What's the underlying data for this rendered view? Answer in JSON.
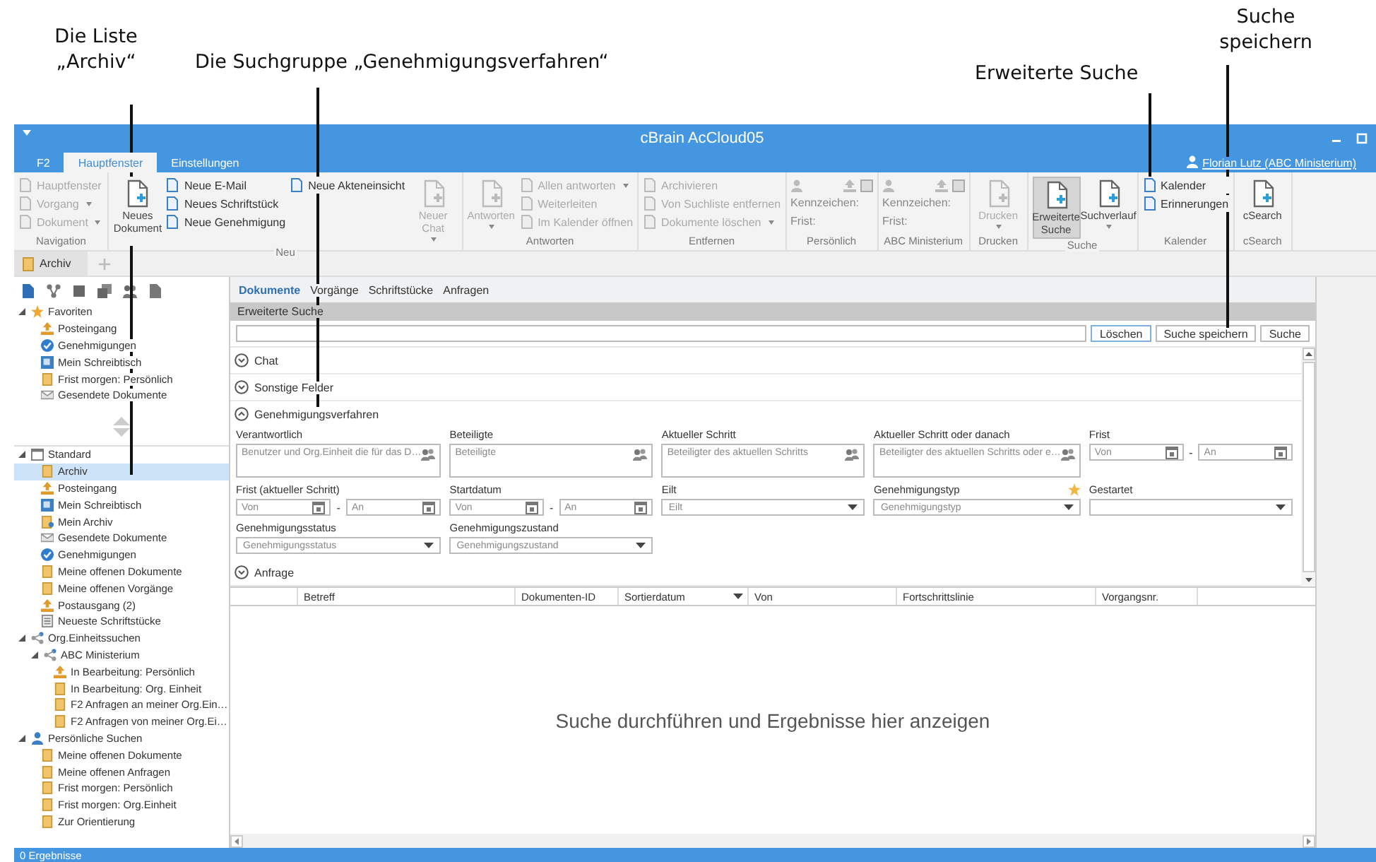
{
  "annotations": [
    {
      "text": "Die Liste „Archiv“"
    },
    {
      "text": "Die Suchgruppe „Genehmigungsverfahren“"
    },
    {
      "text": "Erweiterte Suche"
    },
    {
      "text": "Suche speichern"
    }
  ],
  "window": {
    "title": "cBrain AcCloud05"
  },
  "ribbon_tabs": [
    {
      "label": "F2",
      "selected": false
    },
    {
      "label": "Hauptfenster",
      "selected": true
    },
    {
      "label": "Einstellungen",
      "selected": false
    }
  ],
  "user": "Florian Lutz (ABC Ministerium)",
  "ribbon_groups": [
    {
      "label": "Navigation",
      "items": [
        {
          "kind": "small",
          "label": "Hauptfenster",
          "disabled": true,
          "dropdown": false
        },
        {
          "kind": "small",
          "label": "Vorgang",
          "disabled": true,
          "dropdown": true
        },
        {
          "kind": "small",
          "label": "Dokument",
          "disabled": true,
          "dropdown": true
        }
      ]
    },
    {
      "label": "Neu",
      "items": [
        {
          "kind": "large",
          "label": "Neues Dokument",
          "disabled": false,
          "dropdown": false
        },
        {
          "kind": "small",
          "label": "Neue E-Mail",
          "disabled": false,
          "dropdown": false
        },
        {
          "kind": "small",
          "label": "Neues Schriftstück",
          "disabled": false,
          "dropdown": false
        },
        {
          "kind": "small",
          "label": "Neue Genehmigung",
          "disabled": false,
          "dropdown": false
        },
        {
          "kind": "small",
          "label": "Neue Akteneinsicht",
          "disabled": false,
          "dropdown": false
        },
        {
          "kind": "large",
          "label": "Neuer Chat",
          "disabled": true,
          "dropdown": true
        }
      ]
    },
    {
      "label": "Antworten",
      "items": [
        {
          "kind": "large",
          "label": "Antworten",
          "disabled": true,
          "dropdown": true
        },
        {
          "kind": "small",
          "label": "Allen antworten",
          "disabled": true,
          "dropdown": true
        },
        {
          "kind": "small",
          "label": "Weiterleiten",
          "disabled": true,
          "dropdown": false
        },
        {
          "kind": "small",
          "label": "Im Kalender öffnen",
          "disabled": true,
          "dropdown": false
        }
      ]
    },
    {
      "label": "Entfernen",
      "items": [
        {
          "kind": "small",
          "label": "Archivieren",
          "disabled": true,
          "dropdown": false
        },
        {
          "kind": "small",
          "label": "Von Suchliste entfernen",
          "disabled": true,
          "dropdown": false
        },
        {
          "kind": "small",
          "label": "Dokumente löschen",
          "disabled": true,
          "dropdown": true
        }
      ]
    },
    {
      "label": "Persönlich",
      "items": [
        {
          "kind": "icons"
        },
        {
          "kind": "field",
          "label": "Kennzeichen:"
        },
        {
          "kind": "field",
          "label": "Frist:"
        }
      ]
    },
    {
      "label": "ABC Ministerium",
      "items": [
        {
          "kind": "icons"
        },
        {
          "kind": "field",
          "label": "Kennzeichen:"
        },
        {
          "kind": "field",
          "label": "Frist:"
        }
      ]
    },
    {
      "label": "Drucken",
      "items": [
        {
          "kind": "large",
          "label": "Drucken",
          "disabled": true,
          "dropdown": true
        }
      ]
    },
    {
      "label": "Suche",
      "items": [
        {
          "kind": "large",
          "label": "Erweiterte Suche",
          "disabled": false,
          "dropdown": false,
          "selected": true
        },
        {
          "kind": "large",
          "label": "Suchverlauf",
          "disabled": false,
          "dropdown": true,
          "selected": false
        }
      ]
    },
    {
      "label": "Kalender",
      "items": [
        {
          "kind": "small",
          "label": "Kalender",
          "disabled": false,
          "dropdown": false
        },
        {
          "kind": "small",
          "label": "Erinnerungen",
          "disabled": false,
          "dropdown": false
        }
      ]
    },
    {
      "label": "cSearch",
      "items": [
        {
          "kind": "large",
          "label": "cSearch",
          "disabled": false,
          "dropdown": false
        }
      ]
    }
  ],
  "doc_tabs": [
    {
      "label": "Archiv",
      "selected": true
    }
  ],
  "sidebar": {
    "favorites": {
      "label": "Favoriten",
      "kind": "star",
      "expanded": true,
      "selected": false,
      "children": [
        {
          "label": "Posteingang",
          "kind": "inbox",
          "selected": false
        },
        {
          "label": "Genehmigungen",
          "kind": "approval",
          "selected": false
        },
        {
          "label": "Mein Schreibtisch",
          "kind": "desk",
          "selected": false
        },
        {
          "label": "Frist morgen: Persönlich",
          "kind": "doc",
          "selected": false
        },
        {
          "label": "Gesendete Dokumente",
          "kind": "sent",
          "selected": false
        }
      ]
    },
    "searches": [
      {
        "label": "Standard",
        "kind": "calendar",
        "expanded": true,
        "selected": false,
        "children": [
          {
            "label": "Archiv",
            "kind": "doc",
            "selected": true
          },
          {
            "label": "Posteingang",
            "kind": "inbox",
            "selected": false
          },
          {
            "label": "Mein Schreibtisch",
            "kind": "desk",
            "selected": false
          },
          {
            "label": "Mein Archiv",
            "kind": "archive",
            "selected": false
          },
          {
            "label": "Gesendete Dokumente",
            "kind": "sent",
            "selected": false
          },
          {
            "label": "Genehmigungen",
            "kind": "approval",
            "selected": false
          },
          {
            "label": "Meine offenen Dokumente",
            "kind": "doc",
            "selected": false
          },
          {
            "label": "Meine offenen Vorgänge",
            "kind": "doc",
            "selected": false
          },
          {
            "label": "Postausgang (2)",
            "kind": "inbox",
            "selected": false
          },
          {
            "label": "Neueste Schriftstücke",
            "kind": "list",
            "selected": false
          }
        ]
      },
      {
        "label": "Org.Einheitssuchen",
        "kind": "org",
        "expanded": true,
        "selected": false,
        "children": [
          {
            "label": "ABC Ministerium",
            "kind": "org",
            "expanded": true,
            "selected": false,
            "children": [
              {
                "label": "In Bearbeitung: Persönlich",
                "kind": "inbox",
                "selected": false
              },
              {
                "label": "In Bearbeitung: Org. Einheit",
                "kind": "doc",
                "selected": false
              },
              {
                "label": "F2 Anfragen an meiner Org.Ein…",
                "kind": "doc",
                "selected": false
              },
              {
                "label": "F2 Anfragen von meiner Org.Ei…",
                "kind": "doc",
                "selected": false
              }
            ]
          }
        ]
      },
      {
        "label": "Persönliche Suchen",
        "kind": "person",
        "expanded": true,
        "selected": false,
        "children": [
          {
            "label": "Meine offenen Dokumente",
            "kind": "doc",
            "selected": false
          },
          {
            "label": "Meine offenen Anfragen",
            "kind": "doc",
            "selected": false
          },
          {
            "label": "Frist morgen: Persönlich",
            "kind": "doc",
            "selected": false
          },
          {
            "label": "Frist morgen: Org.Einheit",
            "kind": "doc",
            "selected": false
          },
          {
            "label": "Zur Orientierung",
            "kind": "doc",
            "selected": false
          }
        ]
      }
    ]
  },
  "sub_tabs": [
    {
      "label": "Dokumente",
      "selected": true
    },
    {
      "label": "Vorgänge",
      "selected": false
    },
    {
      "label": "Schriftstücke",
      "selected": false
    },
    {
      "label": "Anfragen",
      "selected": false
    }
  ],
  "search": {
    "header": "Erweiterte Suche",
    "buttons": [
      "Löschen",
      "Suche speichern",
      "Suche"
    ]
  },
  "sections": [
    {
      "label": "Chat",
      "expanded": false
    },
    {
      "label": "Sonstige Felder",
      "expanded": false
    },
    {
      "label": "Genehmigungsverfahren",
      "expanded": true,
      "fields": [
        {
          "kind": "picker",
          "label": "Verantwortlich",
          "placeholder": "Benutzer und Org.Einheit die für das D…"
        },
        {
          "kind": "picker",
          "label": "Beteiligte",
          "placeholder": "Beteiligte"
        },
        {
          "kind": "picker",
          "label": "Aktueller Schritt",
          "placeholder": "Beteiligter des aktuellen Schritts"
        },
        {
          "kind": "picker",
          "label": "Aktueller Schritt oder danach",
          "placeholder": "Beteiligter des aktuellen Schritts oder e…"
        },
        {
          "kind": "daterange",
          "label": "Frist",
          "from": "Von",
          "separator": "-",
          "to": "An"
        },
        {
          "kind": "daterange",
          "label": "Frist (aktueller Schritt)",
          "from": "Von",
          "separator": "-",
          "to": "An"
        },
        {
          "kind": "daterange",
          "label": "Startdatum",
          "from": "Von",
          "separator": "-",
          "to": "An"
        },
        {
          "kind": "select",
          "label": "Eilt",
          "placeholder": "Eilt"
        },
        {
          "kind": "select",
          "label": "Genehmigungstyp",
          "placeholder": "Genehmigungstyp",
          "starred": true
        },
        {
          "kind": "select",
          "label": "Gestartet"
        },
        {
          "kind": "select",
          "label": "Genehmigungsstatus",
          "placeholder": "Genehmigungsstatus"
        },
        {
          "kind": "select",
          "label": "Genehmigungszustand",
          "placeholder": "Genehmigungszustand"
        }
      ]
    },
    {
      "label": "Anfrage",
      "expanded": false
    }
  ],
  "table": {
    "columns": [
      {
        "label": "Betreff",
        "sorted": false
      },
      {
        "label": "Dokumenten-ID",
        "sorted": false
      },
      {
        "label": "Sortierdatum",
        "sorted": true
      },
      {
        "label": "Von",
        "sorted": false
      },
      {
        "label": "Fortschrittslinie",
        "sorted": false
      },
      {
        "label": "Vorgangsnr.",
        "sorted": false
      }
    ],
    "empty_message": "Suche durchführen und Ergebnisse hier anzeigen"
  },
  "status_bar": {
    "text": "0 Ergebnisse"
  }
}
